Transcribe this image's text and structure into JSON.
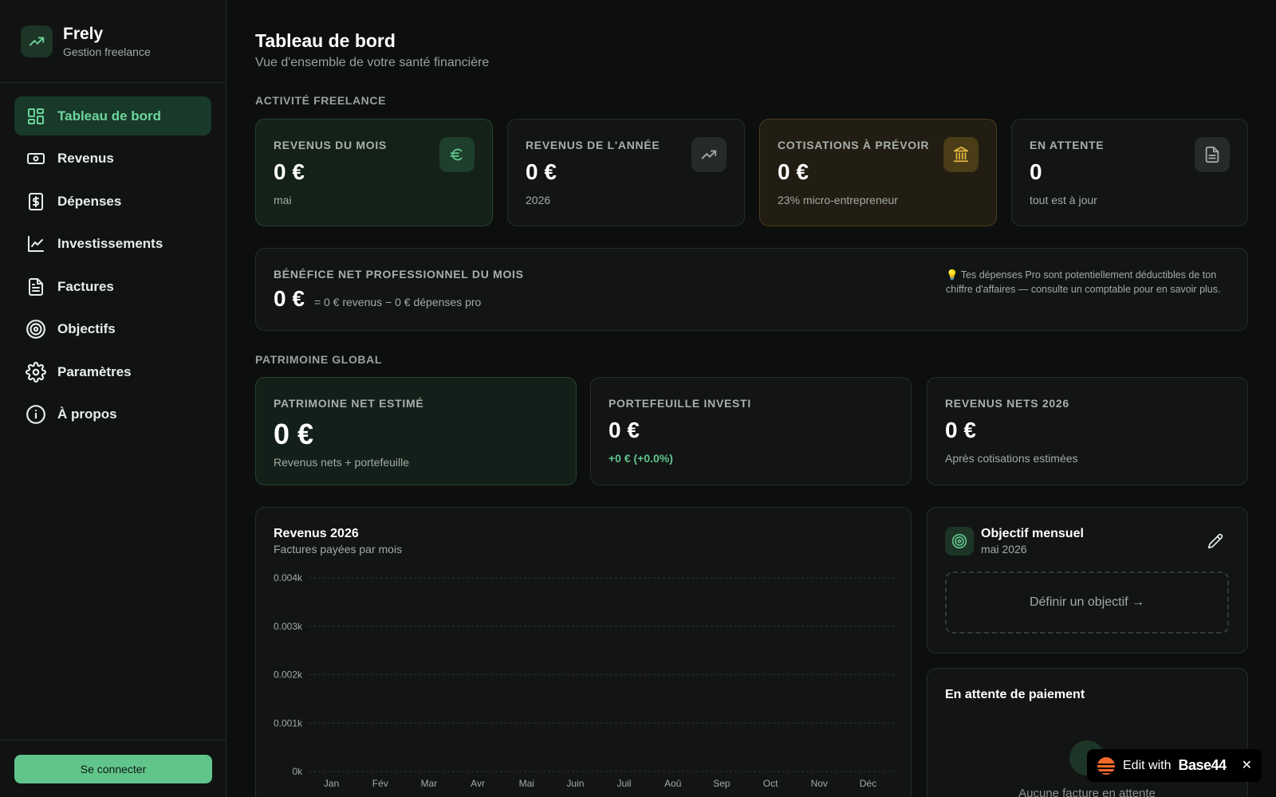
{
  "brand": {
    "name": "Frely",
    "subtitle": "Gestion freelance"
  },
  "sidebar": {
    "items": [
      {
        "label": "Tableau de bord",
        "icon": "dashboard-icon",
        "active": true
      },
      {
        "label": "Revenus",
        "icon": "banknote-icon"
      },
      {
        "label": "Dépenses",
        "icon": "receipt-icon"
      },
      {
        "label": "Investissements",
        "icon": "line-chart-icon"
      },
      {
        "label": "Factures",
        "icon": "file-text-icon"
      },
      {
        "label": "Objectifs",
        "icon": "target-icon"
      },
      {
        "label": "Paramètres",
        "icon": "gear-icon"
      },
      {
        "label": "À propos",
        "icon": "info-icon"
      }
    ],
    "connect_label": "Se connecter"
  },
  "header": {
    "title": "Tableau de bord",
    "subtitle": "Vue d'ensemble de votre santé financière"
  },
  "activity": {
    "section_label": "ACTIVITÉ FREELANCE",
    "cards": [
      {
        "label": "REVENUS DU MOIS",
        "value": "0 €",
        "note": "mai",
        "icon": "euro-icon",
        "accent": "#61c48b"
      },
      {
        "label": "REVENUS DE L'ANNÉE",
        "value": "0 €",
        "note": "2026",
        "icon": "trending-up-icon",
        "accent": "#a4aaa7"
      },
      {
        "label": "COTISATIONS À PRÉVOIR",
        "value": "0 €",
        "note": "23% micro-entrepreneur",
        "icon": "bank-icon",
        "accent": "#e3b341"
      },
      {
        "label": "EN ATTENTE",
        "value": "0",
        "note": "tout est à jour",
        "icon": "document-icon",
        "accent": "#a4aaa7"
      }
    ]
  },
  "benefit": {
    "label": "BÉNÉFICE NET PROFESSIONNEL DU MOIS",
    "value": "0 €",
    "detail": "= 0 € revenus − 0 € dépenses pro",
    "tip": "💡 Tes dépenses Pro sont potentiellement déductibles de ton chiffre d'affaires — consulte un comptable pour en savoir plus."
  },
  "patrimoine": {
    "section_label": "PATRIMOINE GLOBAL",
    "cards": [
      {
        "label": "PATRIMOINE NET ESTIMÉ",
        "value": "0 €",
        "note": "Revenus nets + portefeuille"
      },
      {
        "label": "PORTEFEUILLE INVESTI",
        "value": "0 €",
        "note": "+0 € (+0.0%)"
      },
      {
        "label": "REVENUS NETS 2026",
        "value": "0 €",
        "note": "Après cotisations estimées"
      }
    ]
  },
  "chart_data": {
    "type": "bar",
    "title": "Revenus 2026",
    "subtitle": "Factures payées par mois",
    "categories": [
      "Jan",
      "Fév",
      "Mar",
      "Avr",
      "Mai",
      "Juin",
      "Juil",
      "Aoû",
      "Sep",
      "Oct",
      "Nov",
      "Déc"
    ],
    "values": [
      0,
      0,
      0,
      0,
      0,
      0,
      0,
      0,
      0,
      0,
      0,
      0
    ],
    "y_ticks": [
      "0.004k",
      "0.003k",
      "0.002k",
      "0.001k",
      "0k"
    ],
    "ylim": [
      0,
      0.004
    ],
    "grid": true
  },
  "objectif": {
    "title": "Objectif mensuel",
    "subtitle": "mai 2026",
    "define_label": "Définir un objectif →"
  },
  "pending": {
    "title": "En attente de paiement",
    "empty_text": "Aucune facture en attente"
  },
  "edit_badge": {
    "text": "Edit with",
    "brand": "Base44",
    "close": "✕"
  }
}
